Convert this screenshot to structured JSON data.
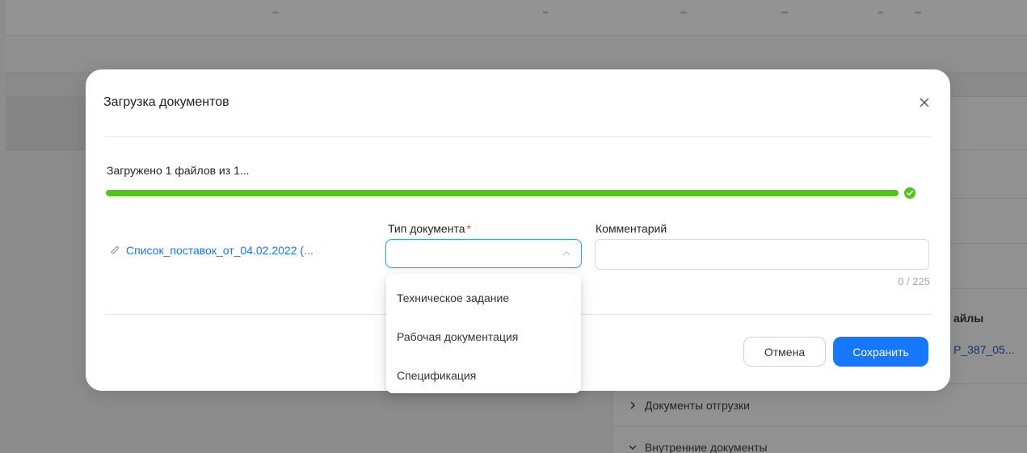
{
  "background": {
    "files_title": "айлы",
    "files_link": "P_387_05...",
    "sections": [
      {
        "label": "Документы отгрузки",
        "chevron": "chevron-right-icon"
      },
      {
        "label": "Внутренние документы",
        "chevron": "chevron-down-icon"
      }
    ]
  },
  "modal": {
    "title": "Загрузка документов",
    "close_icon": "close-icon",
    "upload_status": "Загружено 1 файлов из 1...",
    "progress_percent": 100,
    "progress_color": "#52c41a",
    "file": {
      "name": "Список_поставок_от_04.02.2022 (...",
      "icon": "paperclip-icon"
    },
    "doc_type": {
      "label": "Тип документа",
      "required_mark": "*",
      "value": "",
      "options": [
        "Техническое задание",
        "Рабочая документация",
        "Спецификация"
      ]
    },
    "comment": {
      "label": "Комментарий",
      "value": "",
      "placeholder": "",
      "char_count": "0 / 225"
    },
    "buttons": {
      "cancel": "Отмена",
      "save": "Сохранить"
    },
    "accent_color": "#1677ff"
  }
}
